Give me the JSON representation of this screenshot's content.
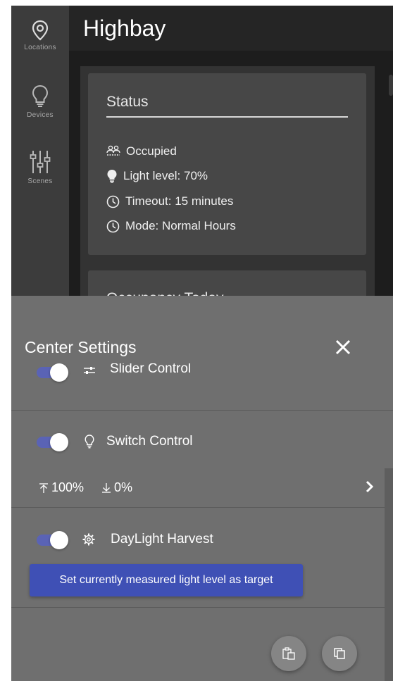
{
  "sidebar": {
    "items": [
      {
        "label": "Locations",
        "icon": "location-pin-icon"
      },
      {
        "label": "Devices",
        "icon": "lightbulb-icon"
      },
      {
        "label": "Scenes",
        "icon": "sliders-icon"
      }
    ]
  },
  "header": {
    "title": "Highbay"
  },
  "status_card": {
    "title": "Status",
    "rows": [
      {
        "icon": "people-icon",
        "text": "Occupied"
      },
      {
        "icon": "bulb-filled-icon",
        "text": "Light level: 70%"
      },
      {
        "icon": "clock-icon",
        "text": "Timeout: 15 minutes"
      },
      {
        "icon": "clock-icon",
        "text": "Mode: Normal Hours"
      }
    ]
  },
  "occupancy_card": {
    "title": "Occupancy Today"
  },
  "sheet": {
    "title": "Center Settings",
    "controls": [
      {
        "label": "Slider Control",
        "enabled": true,
        "icon": "slider-control-icon"
      },
      {
        "label": "Switch Control",
        "enabled": true,
        "icon": "lightbulb-outline-icon"
      },
      {
        "label": "DayLight Harvest",
        "enabled": true,
        "icon": "gear-icon"
      }
    ],
    "limits": {
      "high": "100%",
      "low": "0%"
    },
    "target_button": "Set currently measured light level as target"
  },
  "colors": {
    "accent": "#3f50b5",
    "toggle_track": "#5a63b5",
    "sheet_bg": "#6f6f6f",
    "sidebar_bg": "#3c3c3c"
  }
}
